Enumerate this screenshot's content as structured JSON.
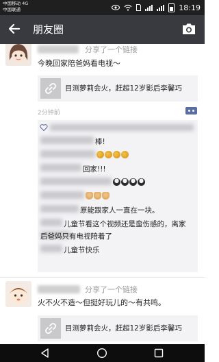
{
  "status_bar": {
    "carrier_1": "中国移动 4G",
    "carrier_2": "中国联通",
    "time": "18:19"
  },
  "header": {
    "title": "朋友圈"
  },
  "posts": [
    {
      "share_text": "分享了一个链接",
      "text": "今晚回家陪爸妈看电视～",
      "link_title": "目测萝莉会火，赶超12岁影后李馨巧",
      "time_ago": "2分钟前",
      "comments": [
        {
          "text": "棒!"
        },
        {
          "emoji": [
            "bear",
            "bear",
            "bear",
            "bear"
          ]
        },
        {
          "text": "回家!!!"
        },
        {
          "emoji": [
            "penguin",
            "penguin",
            "penguin",
            "penguin"
          ]
        },
        {
          "emoji": [
            "palm",
            "palm",
            "palm"
          ]
        },
        {
          "text": "原能跟家人一直在一块。"
        },
        {
          "text": "儿童节看这个视频还是蛮伤感的，离家"
        },
        {
          "text": "后爸妈只有电视陪着了"
        },
        {
          "text": "儿童节快乐"
        }
      ]
    },
    {
      "share_text": "分享了一个链接",
      "text": "火不火不造～但挺好玩儿的～有共鸣。",
      "link_title": "目测萝莉会火，赶超12岁影后李馨巧"
    }
  ],
  "icons": {
    "back": "arrow-left-icon",
    "camera": "camera-icon",
    "link": "link-icon",
    "more": "more-icon",
    "like": "heart-icon",
    "nav_back": "triangle-back-icon",
    "nav_home": "circle-home-icon",
    "nav_recent": "square-recent-icon"
  },
  "colors": {
    "title_bar": "#393a3f",
    "status_bar": "#1f1f1f",
    "link_card": "#f3f3f5",
    "more_button": "#5b6ea1"
  }
}
